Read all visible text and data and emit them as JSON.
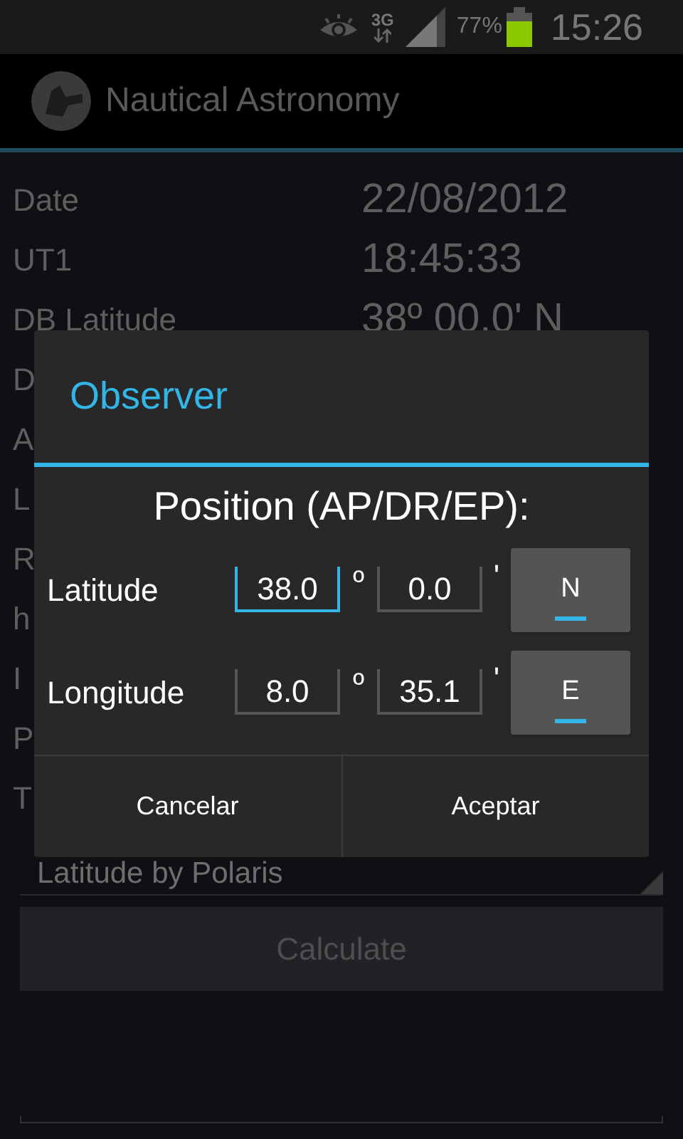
{
  "status_bar": {
    "network": "3G",
    "battery_text": "77%",
    "time": "15:26"
  },
  "action_bar": {
    "title": "Nautical Astronomy"
  },
  "rows": [
    {
      "label": "Date",
      "value": "22/08/2012"
    },
    {
      "label": "UT1",
      "value": "18:45:33"
    },
    {
      "label": "DB Latitude",
      "value": "38º 00.0' N"
    },
    {
      "label": "D"
    },
    {
      "label": "A"
    },
    {
      "label": "L"
    },
    {
      "label": "R"
    },
    {
      "label": "h"
    },
    {
      "label": "I"
    },
    {
      "label": "P"
    },
    {
      "label": "T"
    }
  ],
  "spinner": {
    "value": "Latitude by Polaris"
  },
  "calculate_button": {
    "label": "Calculate",
    "disabled": true
  },
  "dialog": {
    "title": "Observer",
    "heading": "Position (AP/DR/EP):",
    "rows": [
      {
        "label": "Latitude",
        "degrees": "38.0",
        "degree_sign": "º",
        "minutes": "0.0",
        "minute_sign": "'",
        "degrees_focused": true,
        "hemisphere": "N",
        "hemisphere_on": true
      },
      {
        "label": "Longitude",
        "degrees": "8.0",
        "degree_sign": "º",
        "minutes": "35.1",
        "minute_sign": "'",
        "degrees_focused": false,
        "hemisphere": "E",
        "hemisphere_on": true
      }
    ],
    "buttons": [
      "Cancelar",
      "Aceptar"
    ]
  }
}
